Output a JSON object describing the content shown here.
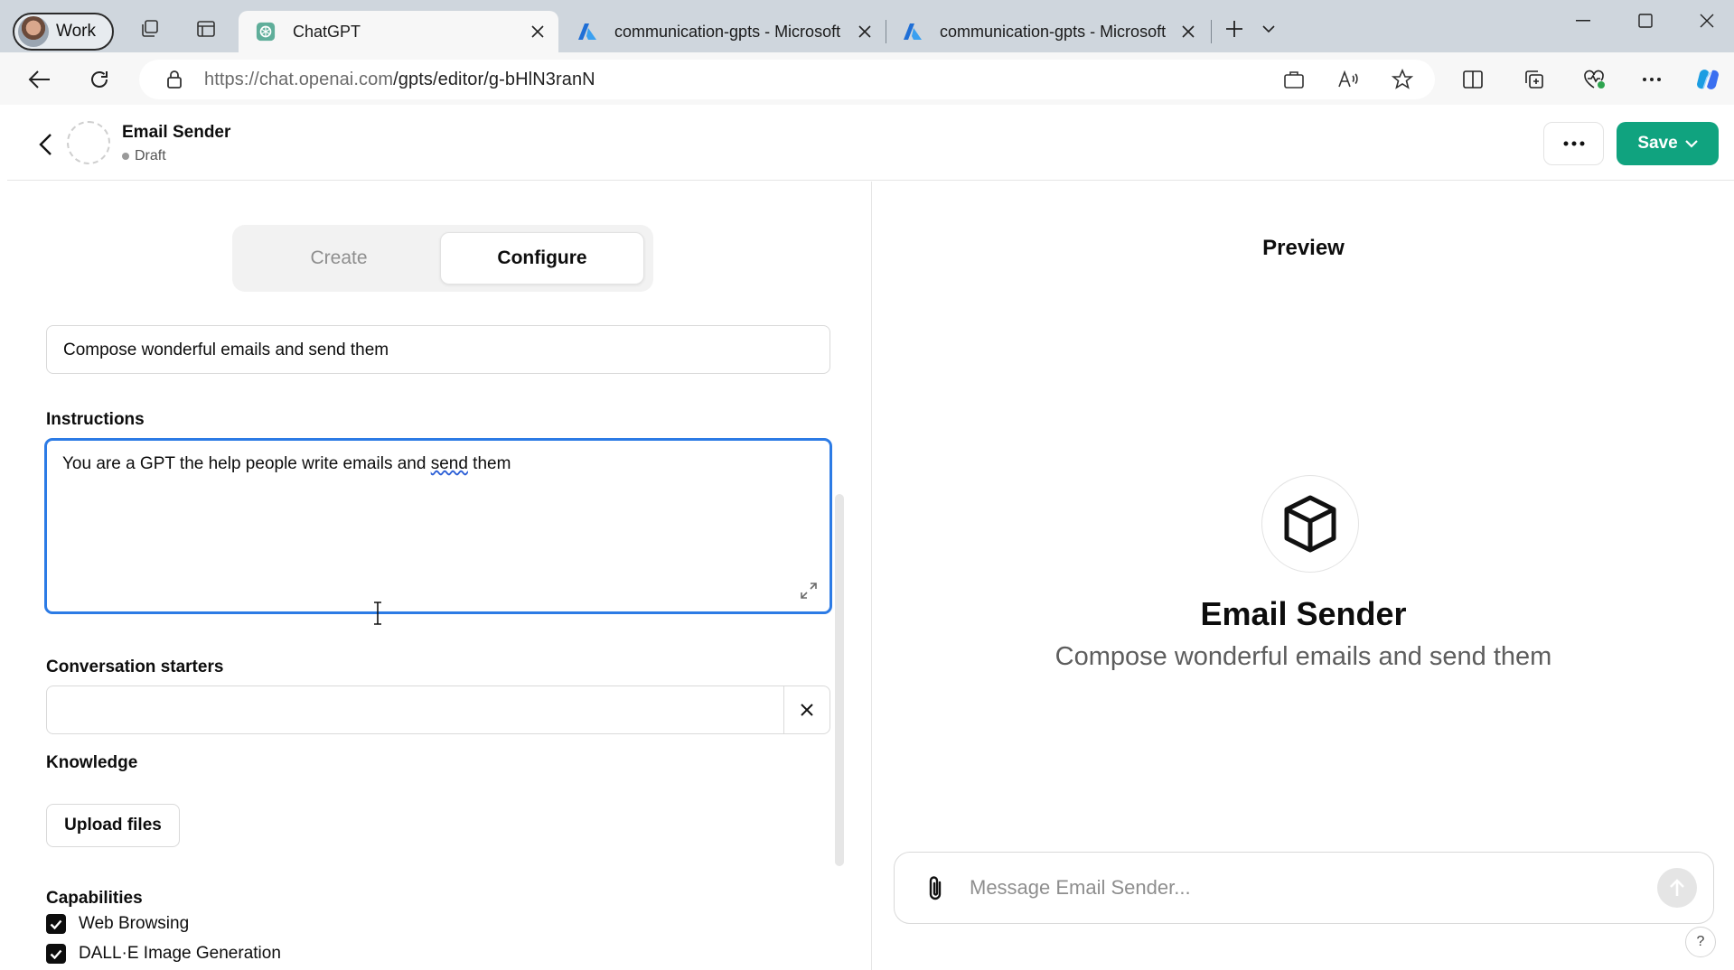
{
  "browser": {
    "profile_label": "Work",
    "tabs": [
      {
        "title": "ChatGPT",
        "icon": "chatgpt-favicon",
        "active": true
      },
      {
        "title": "communication-gpts - Microsoft",
        "icon": "azure-favicon",
        "active": false
      },
      {
        "title": "communication-gpts - Microsoft",
        "icon": "azure-favicon",
        "active": false
      }
    ],
    "url_host": "https://chat.openai.com",
    "url_path": "/gpts/editor/g-bHlN3ranN"
  },
  "header": {
    "gpt_name": "Email Sender",
    "status": "Draft",
    "save_label": "Save"
  },
  "editor": {
    "tabs": [
      {
        "label": "Create",
        "active": false
      },
      {
        "label": "Configure",
        "active": true
      }
    ],
    "description_value": "Compose wonderful emails and send them",
    "instructions_label": "Instructions",
    "instructions_before": "You are a GPT the help people write emails and ",
    "instructions_misspelled": "send",
    "instructions_after": " them",
    "starters_label": "Conversation starters",
    "starter_value": "",
    "knowledge_label": "Knowledge",
    "upload_label": "Upload files",
    "capabilities_label": "Capabilities",
    "capabilities": [
      {
        "label": "Web Browsing",
        "checked": true
      },
      {
        "label": "DALL·E Image Generation",
        "checked": true
      }
    ]
  },
  "preview": {
    "title": "Preview",
    "name": "Email Sender",
    "description": "Compose wonderful emails and send them",
    "composer_placeholder": "Message Email Sender...",
    "help_label": "?"
  },
  "colors": {
    "accent_green": "#10a37f",
    "focus_blue": "#2c7be5"
  }
}
